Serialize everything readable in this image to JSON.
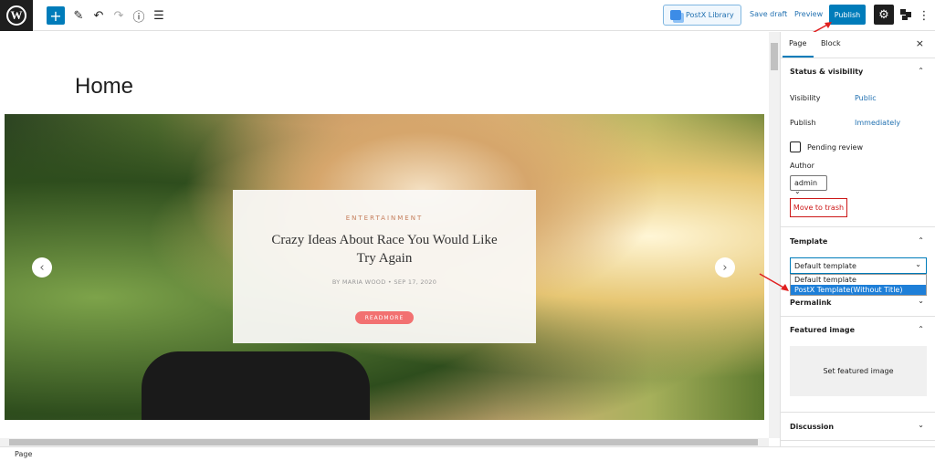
{
  "topbar": {
    "logo_label": "W",
    "add_icon": "+",
    "tools_icon": "✎",
    "undo_icon": "↶",
    "redo_icon": "↷",
    "info_icon": "ⓘ",
    "list_icon": "☰",
    "postx_library": "PostX Library",
    "save_draft": "Save draft",
    "preview": "Preview",
    "publish": "Publish",
    "settings_icon": "⚙",
    "more_icon": "⋮",
    "accent": "#007cba"
  },
  "editor": {
    "page_title": "Home",
    "slide": {
      "category": "ENTERTAINMENT",
      "title": "Crazy Ideas About Race You Would Like Try Again",
      "meta": "BY  MARIA WOOD   •   SEP 17, 2020",
      "button": "READMORE",
      "prev": "‹",
      "next": "›"
    }
  },
  "sidebar": {
    "tabs": [
      "Page",
      "Block"
    ],
    "close": "×",
    "status_visibility": {
      "heading": "Status & visibility",
      "visibility_label": "Visibility",
      "visibility_value": "Public",
      "publish_label": "Publish",
      "publish_value": "Immediately",
      "pending_review": "Pending review",
      "pending_checked": false,
      "author_label": "Author",
      "author_value": "admin",
      "move_to_trash": "Move to trash"
    },
    "template": {
      "heading": "Template",
      "selected": "Default template",
      "options": [
        "Default template",
        "PostX Template(Without Title)"
      ],
      "highlighted": "PostX Template(Without Title)"
    },
    "permalink": "Permalink",
    "featured_image": {
      "heading": "Featured image",
      "button": "Set featured image"
    },
    "discussion": "Discussion"
  },
  "statusbar": {
    "breadcrumb": "Page"
  }
}
